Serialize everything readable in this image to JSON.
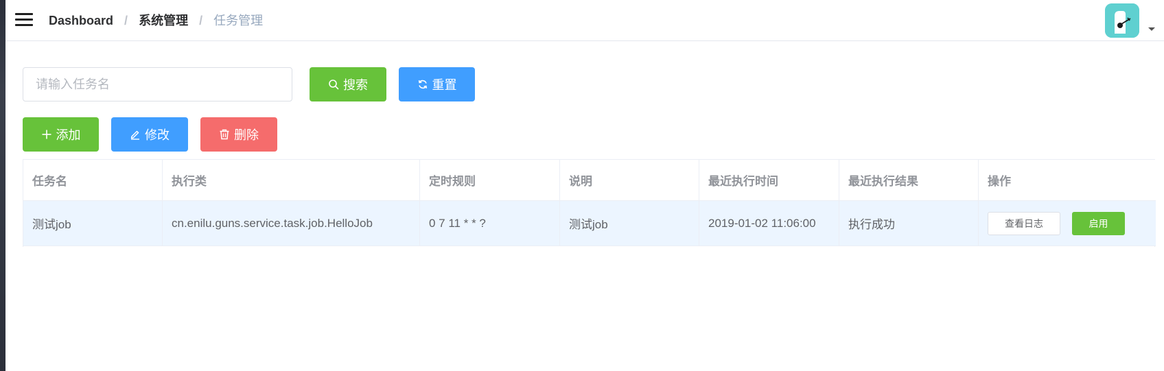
{
  "breadcrumb": {
    "items": [
      "Dashboard",
      "系统管理",
      "任务管理"
    ],
    "separator": "/"
  },
  "search": {
    "placeholder": "请输入任务名",
    "value": "",
    "search_label": "搜索",
    "reset_label": "重置"
  },
  "toolbar": {
    "add_label": "添加",
    "edit_label": "修改",
    "delete_label": "删除"
  },
  "table": {
    "columns": [
      "任务名",
      "执行类",
      "定时规则",
      "说明",
      "最近执行时间",
      "最近执行结果",
      "操作"
    ],
    "rows": [
      {
        "name": "测试job",
        "job_class": "cn.enilu.guns.service.task.job.HelloJob",
        "cron": "0 7 11 * * ?",
        "description": "测试job",
        "last_run_time": "2019-01-02 11:06:00",
        "last_result": "执行成功",
        "view_log_label": "查看日志",
        "enable_label": "启用"
      }
    ]
  },
  "icons": {
    "menu": "hamburger-icon",
    "search": "search-icon",
    "reset": "refresh-icon",
    "add": "plus-icon",
    "edit": "edit-icon",
    "delete": "trash-icon",
    "caret": "caret-down-icon"
  },
  "colors": {
    "success": "#67c23a",
    "primary": "#409eff",
    "danger": "#f56c6c",
    "row_highlight": "#ecf5ff",
    "avatar_bg": "#5fd0d0"
  }
}
